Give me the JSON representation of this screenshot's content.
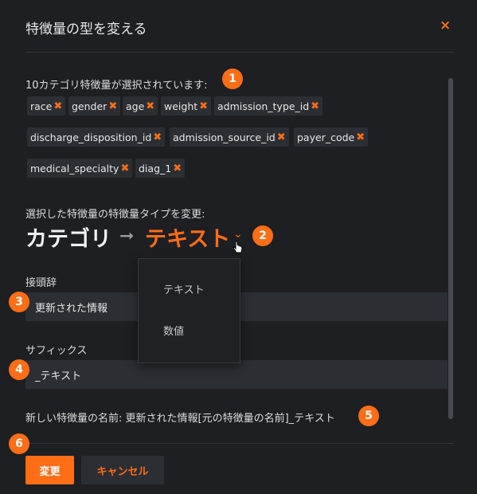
{
  "dialog": {
    "title": "特徴量の型を変える",
    "close_icon": "×"
  },
  "selection": {
    "summary": "10カテゴリ特徴量が選択されています:",
    "chips": [
      "race",
      "gender",
      "age",
      "weight",
      "admission_type_id",
      "discharge_disposition_id",
      "admission_source_id",
      "payer_code",
      "medical_specialty",
      "diag_1"
    ],
    "remove_icon": "✖"
  },
  "type_change": {
    "label": "選択した特徴量の特徴量タイプを変更:",
    "from": "カテゴリ",
    "arrow": "➞",
    "to": "テキスト",
    "chevron": "⌄"
  },
  "dropdown": {
    "options": [
      "テキスト",
      "数値"
    ]
  },
  "prefix": {
    "label": "接頭辞",
    "value": "更新された情報"
  },
  "suffix": {
    "label": "サフィックス",
    "value": "_テキスト"
  },
  "new_name": {
    "text": "新しい特徴量の名前: 更新された情報[元の特徴量の名前]_テキスト"
  },
  "buttons": {
    "change": "変更",
    "cancel": "キャンセル"
  },
  "badges": [
    "1",
    "2",
    "3",
    "4",
    "5",
    "6"
  ],
  "colors": {
    "accent": "#ff6d17",
    "background": "#1d1f22",
    "field": "#2b2e33"
  }
}
